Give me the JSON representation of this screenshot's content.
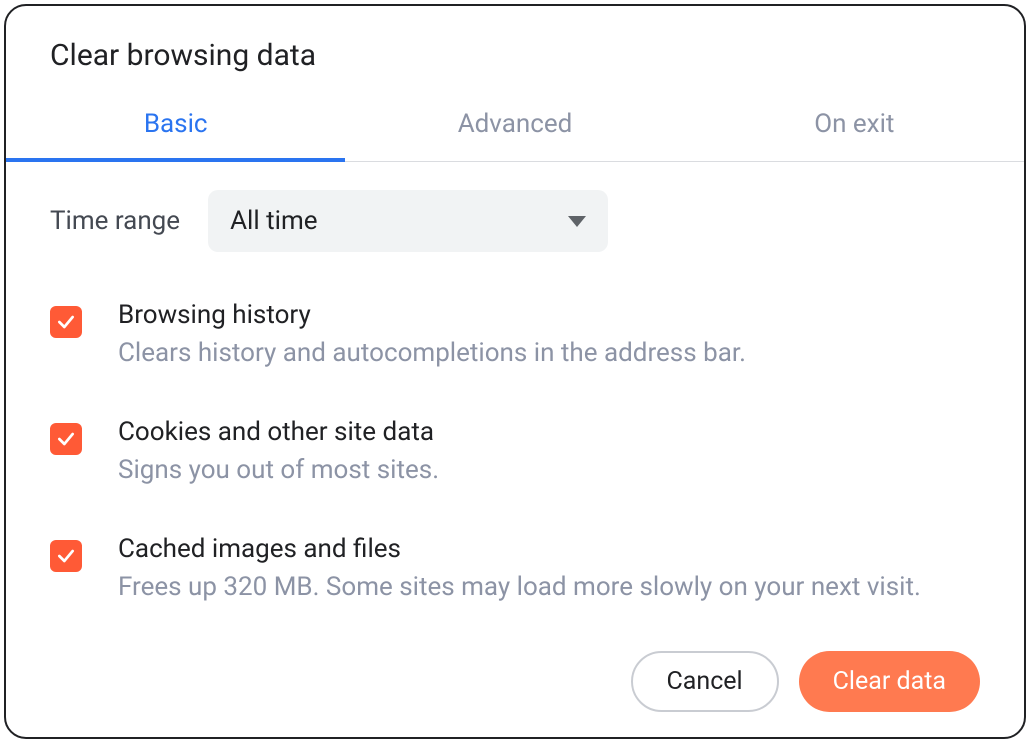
{
  "dialog": {
    "title": "Clear browsing data"
  },
  "tabs": {
    "basic": "Basic",
    "advanced": "Advanced",
    "on_exit": "On exit"
  },
  "time": {
    "label": "Time range",
    "selected": "All time"
  },
  "options": {
    "history": {
      "title": "Browsing history",
      "desc": "Clears history and autocompletions in the address bar."
    },
    "cookies": {
      "title": "Cookies and other site data",
      "desc": "Signs you out of most sites."
    },
    "cache": {
      "title": "Cached images and files",
      "desc": "Frees up 320 MB. Some sites may load more slowly on your next visit."
    }
  },
  "footer": {
    "cancel": "Cancel",
    "clear": "Clear data"
  }
}
